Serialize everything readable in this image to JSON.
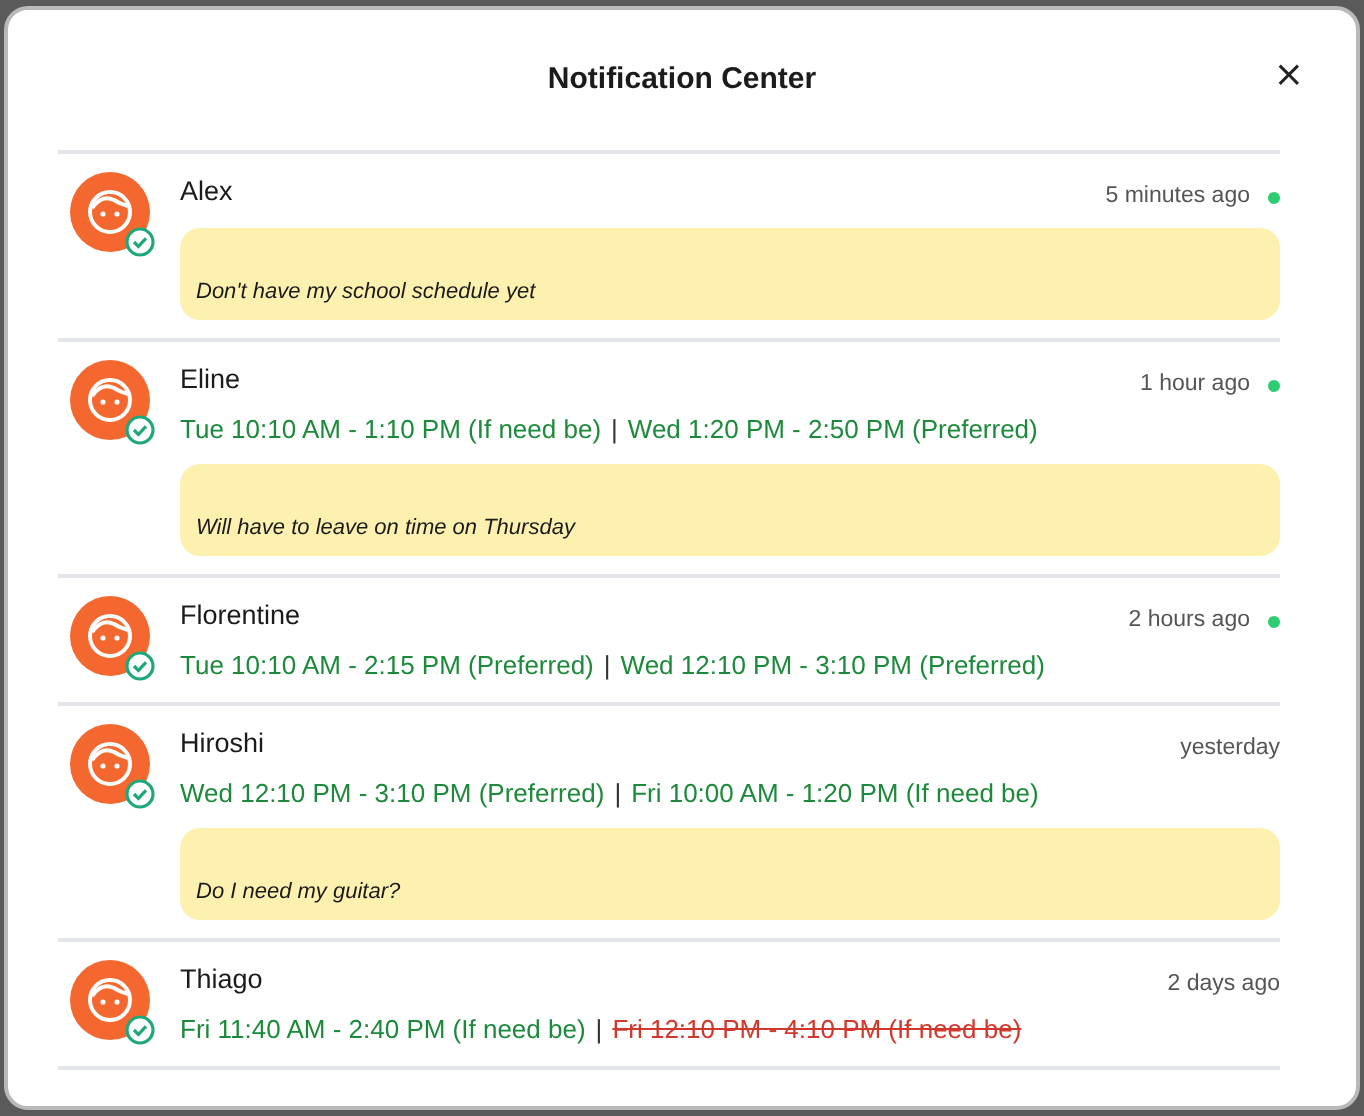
{
  "dialog": {
    "title": "Notification Center",
    "close": "×"
  },
  "notifications": [
    {
      "name": "Alex",
      "time": "5 minutes ago",
      "unread": true,
      "note": "Don't have my school schedule yet"
    },
    {
      "name": "Eline",
      "time": "1 hour ago",
      "unread": true,
      "separator": "|",
      "slots": [
        {
          "text": "Tue 10:10 AM - 1:10 PM (If need be)",
          "removed": false
        },
        {
          "text": "Wed 1:20 PM - 2:50 PM (Preferred)",
          "removed": false
        }
      ],
      "note": "Will have to leave on time on Thursday"
    },
    {
      "name": "Florentine",
      "time": "2 hours ago",
      "unread": true,
      "separator": "|",
      "slots": [
        {
          "text": "Tue 10:10 AM - 2:15 PM (Preferred)",
          "removed": false
        },
        {
          "text": "Wed 12:10 PM - 3:10 PM (Preferred)",
          "removed": false
        }
      ]
    },
    {
      "name": "Hiroshi",
      "time": "yesterday",
      "unread": false,
      "separator": "|",
      "slots": [
        {
          "text": "Wed 12:10 PM - 3:10 PM (Preferred)",
          "removed": false
        },
        {
          "text": "Fri 10:00 AM - 1:20 PM (If need be)",
          "removed": false
        }
      ],
      "note": "Do I need my guitar?"
    },
    {
      "name": "Thiago",
      "time": "2 days ago",
      "unread": false,
      "separator": "|",
      "slots": [
        {
          "text": "Fri 11:40 AM - 2:40 PM (If need be)",
          "removed": false
        },
        {
          "text": "Fri 12:10 PM - 4:10 PM (If need be)",
          "removed": true
        }
      ]
    }
  ]
}
